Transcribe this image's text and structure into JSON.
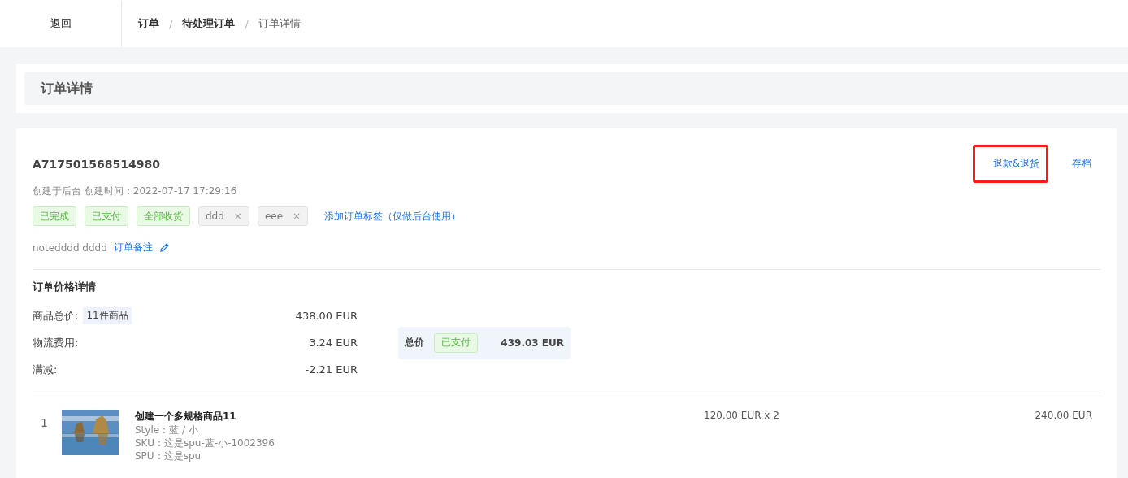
{
  "header": {
    "back": "返回",
    "separator": "/",
    "breadcrumb": [
      {
        "label": "订单",
        "current": false
      },
      {
        "label": "待处理订单",
        "current": false
      },
      {
        "label": "订单详情",
        "current": true
      }
    ]
  },
  "page_title": "订单详情",
  "order": {
    "number": "A717501568514980",
    "created": "创建于后台 创建时间：2022-07-17 17:29:16",
    "actions": [
      {
        "label": "退款&退货",
        "highlighted": true
      },
      {
        "label": "存档",
        "highlighted": false
      }
    ],
    "tags": [
      {
        "kind": "status",
        "label": "已完成"
      },
      {
        "kind": "status",
        "label": "已支付"
      },
      {
        "kind": "status",
        "label": "全部收货"
      },
      {
        "kind": "custom",
        "label": "ddd",
        "close": "×"
      },
      {
        "kind": "custom",
        "label": "eee",
        "close": "×"
      }
    ],
    "add_tag": "添加订单标签（仅做后台使用）",
    "note": "notedddd dddd",
    "note_link": "订单备注"
  },
  "price": {
    "title": "订单价格详情",
    "lines": [
      {
        "label": "商品总价:",
        "badge": "11件商品",
        "amount": "438.00 EUR"
      },
      {
        "label": "物流费用:",
        "amount": "3.24 EUR"
      },
      {
        "label": "满减:",
        "amount": "-2.21 EUR"
      }
    ],
    "total": {
      "label": "总价",
      "status": "已支付",
      "amount": "439.03 EUR"
    }
  },
  "items": [
    {
      "index": "1",
      "kind": "picture",
      "name": "创建一个多规格商品11",
      "details": [
        "Style：蓝 / 小",
        "SKU：这是spu-蓝-小-1002396",
        "SPU：这是spu"
      ],
      "unit": "120.00 EUR x 2",
      "subtotal": "240.00 EUR"
    }
  ]
}
